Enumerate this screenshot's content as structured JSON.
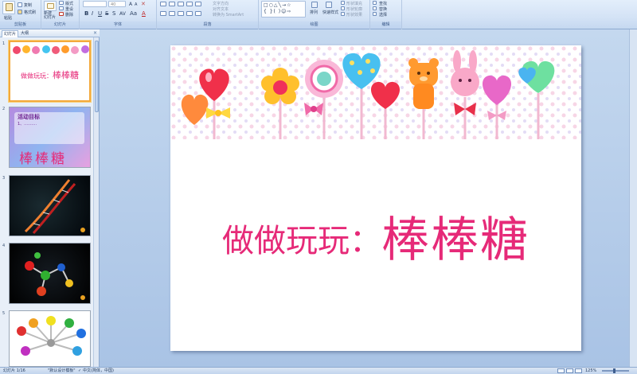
{
  "ribbon": {
    "groups": [
      {
        "label": "剪贴板"
      },
      {
        "label": "幻灯片"
      },
      {
        "label": "字体"
      },
      {
        "label": "段落"
      },
      {
        "label": "绘图"
      },
      {
        "label": "编辑"
      }
    ],
    "paste_label": "粘贴",
    "copy_label": "复制",
    "format_painter_label": "格式刷",
    "new_slide_label": "新建\n幻灯片",
    "layout_label": "版式",
    "reset_label": "重设",
    "delete_label": "删除",
    "font_size_value": "40",
    "text_direction_label": "文字方向",
    "align_text_label": "对齐文本",
    "convert_smartart_label": "转换为 SmartArt",
    "arrange_label": "排列",
    "quick_styles_label": "快速样式",
    "shape_fill_label": "形状填充",
    "shape_outline_label": "形状轮廓",
    "shape_effects_label": "形状效果",
    "find_label": "查找",
    "replace_label": "替换",
    "select_label": "选择"
  },
  "pane": {
    "tabs": [
      {
        "label": "幻灯片"
      },
      {
        "label": "大纲"
      }
    ],
    "close_glyph": "×",
    "thumbnails": [
      {
        "number": "1",
        "title_small": "做做玩玩：",
        "title_big": "棒棒糖",
        "selected": true
      },
      {
        "number": "2",
        "heading": "活动目标",
        "body": "1、..........",
        "title_big": "棒棒糖",
        "selected": false
      },
      {
        "number": "3",
        "selected": false
      },
      {
        "number": "4",
        "selected": false
      },
      {
        "number": "5",
        "selected": false
      }
    ]
  },
  "slide": {
    "title_small": "做做玩玩：",
    "title_big": "棒棒糖"
  },
  "status": {
    "slide_count": "幻灯片 1/16",
    "theme": "\"默认设计模板\"",
    "language": "中文(简体，中国)",
    "zoom": "125%"
  },
  "colors": {
    "accent_pink": "#e62a78",
    "ribbon_blue": "#d4e3f6",
    "workspace_blue": "#a9c3e5"
  }
}
